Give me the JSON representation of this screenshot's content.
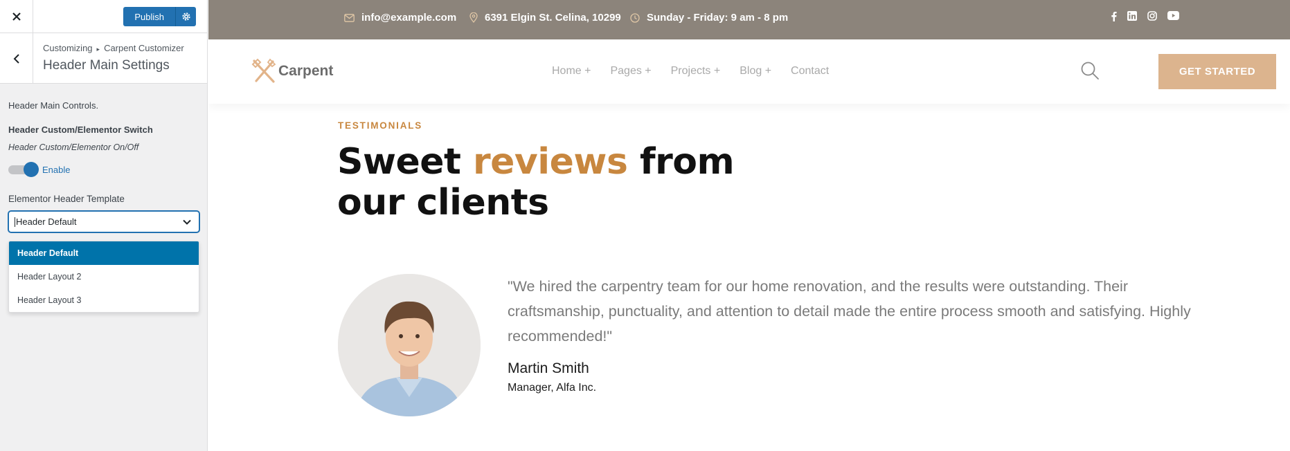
{
  "customizer": {
    "publish_label": "Publish",
    "breadcrumb": {
      "root": "Customizing",
      "section": "Carpent Customizer"
    },
    "panel_title": "Header Main Settings",
    "controls_description": "Header Main Controls.",
    "switch": {
      "title": "Header Custom/Elementor Switch",
      "description": "Header Custom/Elementor On/Off",
      "toggle_label": "Enable",
      "enabled": true
    },
    "template": {
      "title": "Elementor Header Template",
      "selected": "Header Default",
      "options": [
        "Header Default",
        "Header Layout 2",
        "Header Layout 3"
      ]
    }
  },
  "site": {
    "topbar": {
      "email": "info@example.com",
      "address": "6391 Elgin St. Celina, 10299",
      "hours": "Sunday - Friday: 9 am - 8 pm",
      "socials": [
        "facebook-icon",
        "linkedin-icon",
        "instagram-icon",
        "youtube-icon"
      ]
    },
    "logo": "Carpent",
    "menu": [
      "Home +",
      "Pages +",
      "Projects +",
      "Blog +",
      "Contact"
    ],
    "cta_label": "GET STARTED",
    "testimonials": {
      "eyebrow": "TESTIMONIALS",
      "heading_part1": "Sweet ",
      "heading_accent": "reviews",
      "heading_part2": " from",
      "heading_line2": "our clients",
      "quote": "\"We hired the carpentry team for our home renovation, and the results were outstanding. Their craftsmanship, punctuality, and attention to detail made the entire process smooth and satisfying. Highly recommended!\"",
      "author": "Martin Smith",
      "role": "Manager, Alfa Inc."
    }
  },
  "colors": {
    "accent": "#c8873f",
    "topbar": "#8c847b",
    "cta": "#dcb48e",
    "wp_blue": "#2271b1"
  }
}
